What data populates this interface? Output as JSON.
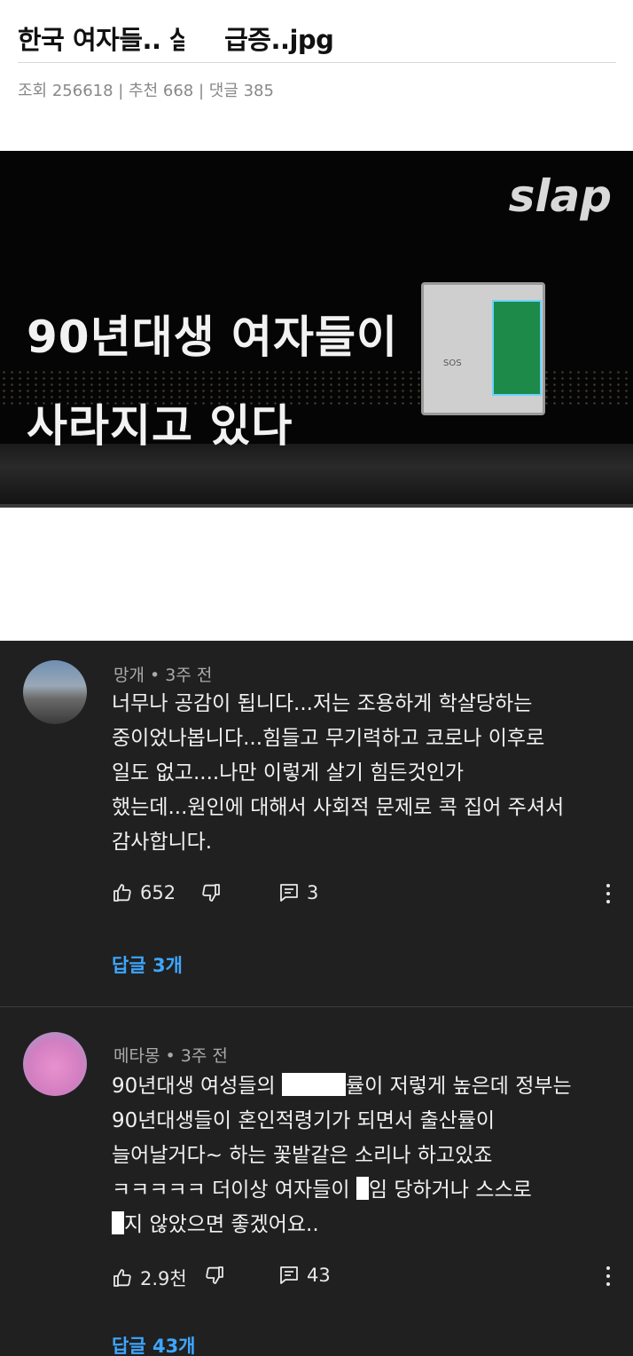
{
  "post": {
    "title": "한국 여자들..        살율 급증..jpg",
    "meta": "조회 256618 | 추천 668 | 댓글 385"
  },
  "thumbnail": {
    "brand": "slap",
    "caption_line1": "90년대생 여자들이",
    "caption_line2": "사라지고 있다",
    "sos_label": "SOS"
  },
  "comments": [
    {
      "author": "망개",
      "time": "3주 전",
      "lines": [
        "너무나 공감이 됩니다...저는 조용하게 학살당하는",
        "중이었나봅니다...힘들고 무기력하고 코로나 이후로",
        "일도 없고....나만 이렇게 살기 힘든것인가",
        "했는데...원인에 대해서 사회적 문제로 콕 집어 주셔서",
        "감사합니다."
      ],
      "likes": "652",
      "reply_count": "3",
      "replies_label": "답글 3개"
    },
    {
      "author": "메타몽",
      "time": "3주 전",
      "line1_a": "90년대생 여성들의 ",
      "line1_b": "률이 저렇게 높은데 정부는",
      "line2": "90년대생들이 혼인적령기가 되면서 출산률이",
      "line3": "늘어날거다~ 하는 꽃밭같은 소리나 하고있죠",
      "line4_a": "ㅋㅋㅋㅋㅋ 더이상 여자들이 ",
      "line4_b": "임 당하거나 스스로",
      "line5_b": "지 않았으면 좋겠어요..",
      "likes": "2.9천",
      "reply_count": "43",
      "replies_label": "답글 43개"
    }
  ],
  "colors": {
    "comment_bg": "#202020",
    "link_blue": "#3ea6ff",
    "meta_gray": "#888888"
  }
}
